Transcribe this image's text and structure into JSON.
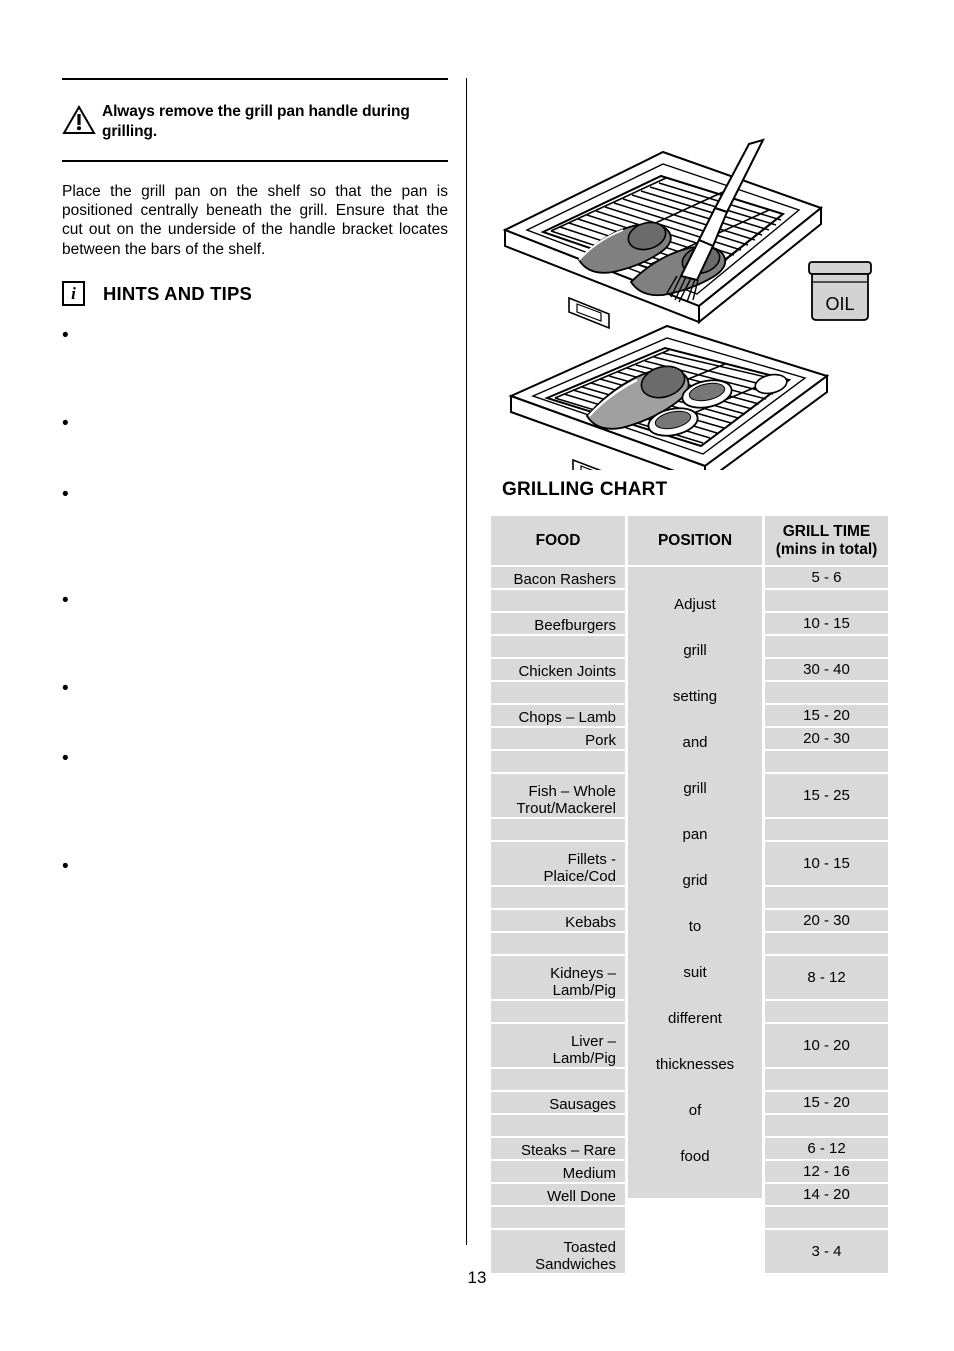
{
  "page": {
    "number": "13"
  },
  "warning": {
    "icon": "warning-triangle-icon",
    "text": "Always remove the grill pan handle during grilling."
  },
  "intro": {
    "paragraph": "Place the grill pan on the shelf so that the pan is positioned centrally beneath the grill.  Ensure that the cut out on the underside of the handle bracket locates between the bars of the shelf."
  },
  "hints": {
    "icon": "info-icon",
    "icon_glyph": "i",
    "title": "HINTS AND TIPS",
    "bullets": [
      "",
      "",
      "",
      "",
      "",
      "",
      ""
    ]
  },
  "figures": [
    {
      "name": "grill-pan-with-brush-and-oil",
      "label": "OIL"
    },
    {
      "name": "grill-pan-with-food",
      "label": ""
    }
  ],
  "chart": {
    "title": "GRILLING CHART",
    "headers": {
      "food": "FOOD",
      "position": "POSITION",
      "grill_time_line1": "GRILL TIME",
      "grill_time_line2": "(mins in total)"
    },
    "position_words": [
      "Adjust",
      "grill",
      "setting",
      "and",
      "grill",
      "pan",
      "grid",
      "to",
      "suit",
      "different",
      "thicknesses",
      "of",
      "food"
    ],
    "rows": [
      {
        "food": "Bacon Rashers",
        "food2": "",
        "time": "5 - 6",
        "lines": 1
      },
      {
        "food": "",
        "food2": "",
        "time": "",
        "lines": 1
      },
      {
        "food": "Beefburgers",
        "food2": "",
        "time": "10 - 15",
        "lines": 1
      },
      {
        "food": "",
        "food2": "",
        "time": "",
        "lines": 1
      },
      {
        "food": "Chicken Joints",
        "food2": "",
        "time": "30 - 40",
        "lines": 1
      },
      {
        "food": "",
        "food2": "",
        "time": "",
        "lines": 1
      },
      {
        "food": "Chops – Lamb",
        "food2": "",
        "time": "15 - 20",
        "lines": 1
      },
      {
        "food": "Pork",
        "food2": "",
        "time": "20 - 30",
        "lines": 1
      },
      {
        "food": "",
        "food2": "",
        "time": "",
        "lines": 1
      },
      {
        "food": "Fish – Whole",
        "food2": "Trout/Mackerel",
        "time": "15 - 25",
        "lines": 2
      },
      {
        "food": "",
        "food2": "",
        "time": "",
        "lines": 1
      },
      {
        "food": "Fillets -",
        "food2": "Plaice/Cod",
        "time": "10 - 15",
        "lines": 2
      },
      {
        "food": "",
        "food2": "",
        "time": "",
        "lines": 1
      },
      {
        "food": "Kebabs",
        "food2": "",
        "time": "20 - 30",
        "lines": 1
      },
      {
        "food": "",
        "food2": "",
        "time": "",
        "lines": 1
      },
      {
        "food": "Kidneys –",
        "food2": "Lamb/Pig",
        "time": "8 - 12",
        "lines": 2
      },
      {
        "food": "",
        "food2": "",
        "time": "",
        "lines": 1
      },
      {
        "food": "Liver –",
        "food2": "Lamb/Pig",
        "time": "10 - 20",
        "lines": 2
      },
      {
        "food": "",
        "food2": "",
        "time": "",
        "lines": 1
      },
      {
        "food": "Sausages",
        "food2": "",
        "time": "15 - 20",
        "lines": 1
      },
      {
        "food": "",
        "food2": "",
        "time": "",
        "lines": 1
      },
      {
        "food": "Steaks – Rare",
        "food2": "",
        "time": "6 - 12",
        "lines": 1
      },
      {
        "food": "Medium",
        "food2": "",
        "time": "12 - 16",
        "lines": 1
      },
      {
        "food": "Well Done",
        "food2": "",
        "time": "14 - 20",
        "lines": 1
      },
      {
        "food": "",
        "food2": "",
        "time": "",
        "lines": 1
      },
      {
        "food": "Toasted",
        "food2": "Sandwiches",
        "time": "3 - 4",
        "lines": 2
      }
    ]
  },
  "colors": {
    "cell_bg": "#d9d9d9",
    "text": "#000000",
    "rule": "#000000",
    "page_bg": "#ffffff"
  }
}
